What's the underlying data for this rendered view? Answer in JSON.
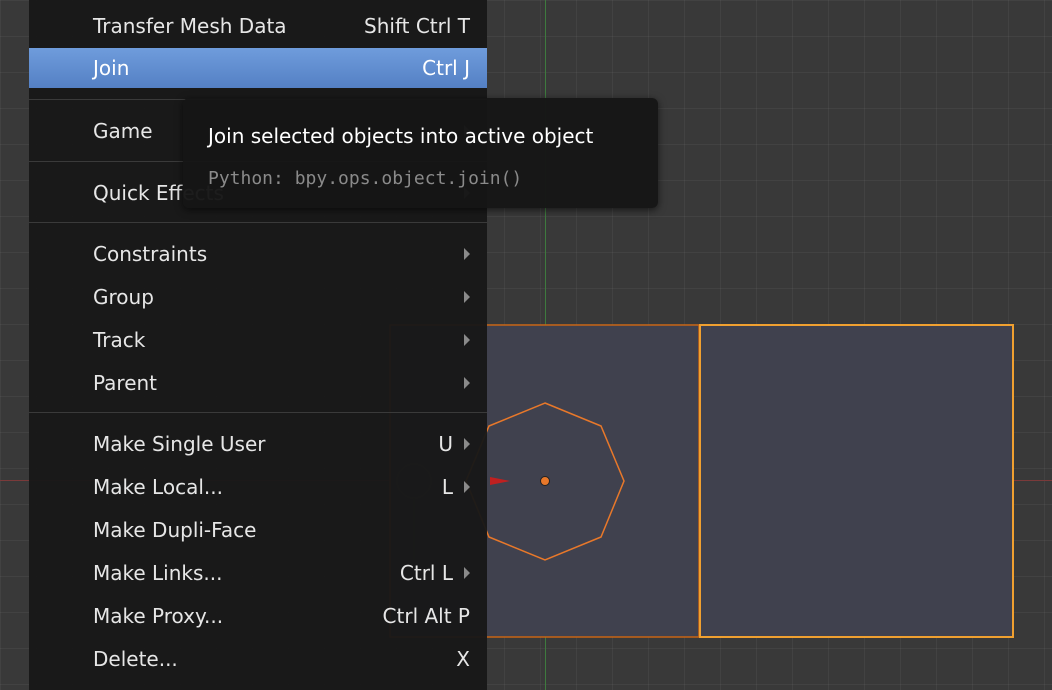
{
  "menu": {
    "items": [
      {
        "label": "Transfer Mesh Data",
        "shortcut": "Shift Ctrl T",
        "submenu": false,
        "highlight": false
      },
      {
        "label": "Join",
        "shortcut": "Ctrl J",
        "submenu": false,
        "highlight": true
      },
      {
        "label": "Game",
        "shortcut": "",
        "submenu": true,
        "highlight": false
      },
      {
        "label": "Quick Effects",
        "shortcut": "",
        "submenu": true,
        "highlight": false
      },
      {
        "label": "Constraints",
        "shortcut": "",
        "submenu": true,
        "highlight": false
      },
      {
        "label": "Group",
        "shortcut": "",
        "submenu": true,
        "highlight": false
      },
      {
        "label": "Track",
        "shortcut": "",
        "submenu": true,
        "highlight": false
      },
      {
        "label": "Parent",
        "shortcut": "",
        "submenu": true,
        "highlight": false
      },
      {
        "label": "Make Single User",
        "shortcut": "U",
        "submenu": true,
        "highlight": false
      },
      {
        "label": "Make Local...",
        "shortcut": "L",
        "submenu": true,
        "highlight": false
      },
      {
        "label": "Make Dupli-Face",
        "shortcut": "",
        "submenu": false,
        "highlight": false
      },
      {
        "label": "Make Links...",
        "shortcut": "Ctrl L",
        "submenu": true,
        "highlight": false
      },
      {
        "label": "Make Proxy...",
        "shortcut": "Ctrl Alt P",
        "submenu": false,
        "highlight": false
      },
      {
        "label": "Delete...",
        "shortcut": "X",
        "submenu": false,
        "highlight": false
      }
    ]
  },
  "tooltip": {
    "title": "Join selected objects into active object",
    "python": "Python: bpy.ops.object.join()"
  },
  "colors": {
    "highlight": "#6f9cdc",
    "selected_outline": "#e8882a",
    "active_outline": "#f0a030",
    "x_axis": "#b03030",
    "y_axis": "#3e8e3e"
  }
}
